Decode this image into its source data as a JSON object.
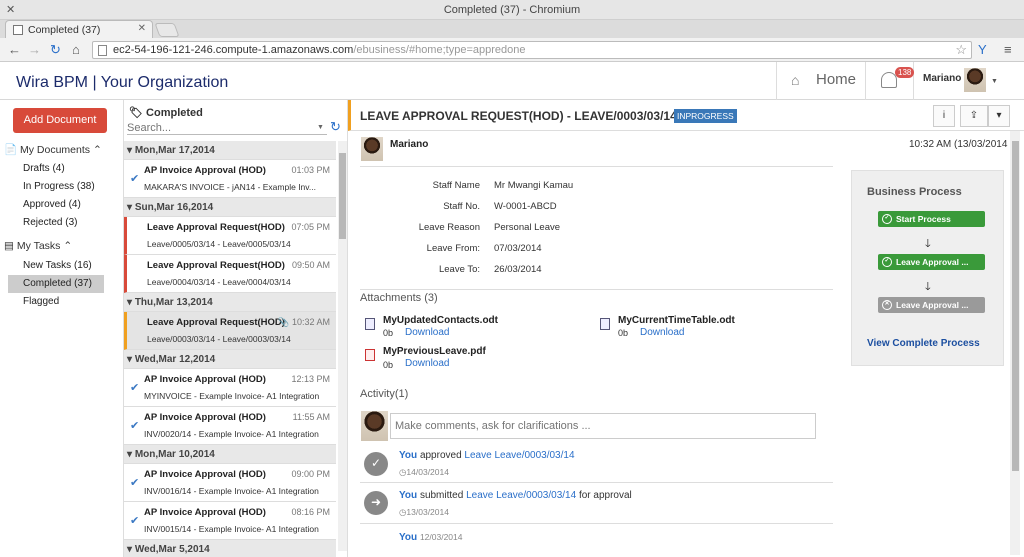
{
  "browser": {
    "window_title": "Completed (37) - Chromium",
    "tab_label": "Completed (37)",
    "url_main": "ec2-54-196-121-246.compute-1.amazonaws.com",
    "url_path": "/ebusiness/#home;type=appredone"
  },
  "app": {
    "brand": "Wira BPM | Your Organization",
    "home_label": "Home",
    "notification_count": "138",
    "user_name": "Mariano"
  },
  "sidebar": {
    "add_document": "Add Document",
    "my_documents": "My Documents",
    "doc_items": [
      "Drafts (4)",
      "In Progress (38)",
      "Approved (4)",
      "Rejected (3)"
    ],
    "my_tasks": "My Tasks",
    "task_items": [
      "New Tasks (16)",
      "Completed (37)",
      "Flagged"
    ]
  },
  "list": {
    "header": "Completed",
    "search_placeholder": "Search...",
    "groups": [
      {
        "date": "Mon,Mar 17,2014",
        "items": [
          {
            "title": "AP Invoice Approval (HOD)",
            "time": "01:03 PM",
            "sub": "MAKARA'S INVOICE - jAN14 - Example Inv..."
          }
        ]
      },
      {
        "date": "Sun,Mar 16,2014",
        "items": [
          {
            "title": "Leave Approval Request(HOD)",
            "time": "07:05 PM",
            "sub": "Leave/0005/03/14 - Leave/0005/03/14"
          },
          {
            "title": "Leave Approval Request(HOD)",
            "time": "09:50 AM",
            "sub": "Leave/0004/03/14 - Leave/0004/03/14"
          }
        ]
      },
      {
        "date": "Thu,Mar 13,2014",
        "items": [
          {
            "title": "Leave Approval Request(HOD)",
            "time": "10:32 AM",
            "sub": "Leave/0003/03/14 - Leave/0003/03/14"
          }
        ]
      },
      {
        "date": "Wed,Mar 12,2014",
        "items": [
          {
            "title": "AP Invoice Approval (HOD)",
            "time": "12:13 PM",
            "sub": "MYINVOICE - Example Invoice- A1 Integration"
          },
          {
            "title": "AP Invoice Approval (HOD)",
            "time": "11:55 AM",
            "sub": "INV/0020/14 - Example Invoice- A1 Integration"
          }
        ]
      },
      {
        "date": "Mon,Mar 10,2014",
        "items": [
          {
            "title": "AP Invoice Approval (HOD)",
            "time": "09:00 PM",
            "sub": "INV/0016/14 - Example Invoice- A1 Integration"
          },
          {
            "title": "AP Invoice Approval (HOD)",
            "time": "08:16 PM",
            "sub": "INV/0015/14 - Example Invoice- A1 Integration"
          }
        ]
      }
    ],
    "partial_group": "Wed,Mar 5,2014"
  },
  "detail": {
    "title": "LEAVE APPROVAL REQUEST(HOD) -  LEAVE/0003/03/14",
    "status": "INPROGRESS",
    "owner": "Mariano",
    "timestamp": "10:32 AM (13/03/2014",
    "fields": [
      {
        "label": "Staff Name",
        "value": "Mr Mwangi Kamau"
      },
      {
        "label": "Staff No.",
        "value": "W-0001-ABCD"
      },
      {
        "label": "Leave Reason",
        "value": "Personal Leave"
      },
      {
        "label": "Leave From:",
        "value": "07/03/2014"
      },
      {
        "label": "Leave To:",
        "value": "26/03/2014"
      }
    ],
    "attachments_title": "Attachments (3)",
    "attachments": [
      {
        "name": "MyUpdatedContacts.odt",
        "size": "0b",
        "link": "Download"
      },
      {
        "name": "MyCurrentTimeTable.odt",
        "size": "0b",
        "link": "Download"
      },
      {
        "name": "MyPreviousLeave.pdf",
        "size": "0b",
        "link": "Download"
      }
    ],
    "activity_title": "Activity(1)",
    "comment_placeholder": "Make comments, ask for clarifications ...",
    "activities": [
      {
        "who": "You",
        "action": "approved",
        "target": "Leave Leave/0003/03/14",
        "suffix": "",
        "date": "14/03/2014"
      },
      {
        "who": "You",
        "action": "submitted",
        "target": "Leave Leave/0003/03/14",
        "suffix": "for approval",
        "date": "13/03/2014"
      },
      {
        "who": "You",
        "action": "",
        "target": "",
        "suffix": "",
        "date": "12/03/2014"
      }
    ]
  },
  "business_process": {
    "title": "Business Process",
    "steps": [
      {
        "label": "Start Process",
        "color": "#3a9a3a"
      },
      {
        "label": "Leave Approval ...",
        "color": "#3a9a3a"
      },
      {
        "label": "Leave Approval ...",
        "color": "#9a9a9a"
      }
    ],
    "link": "View Complete Process"
  }
}
